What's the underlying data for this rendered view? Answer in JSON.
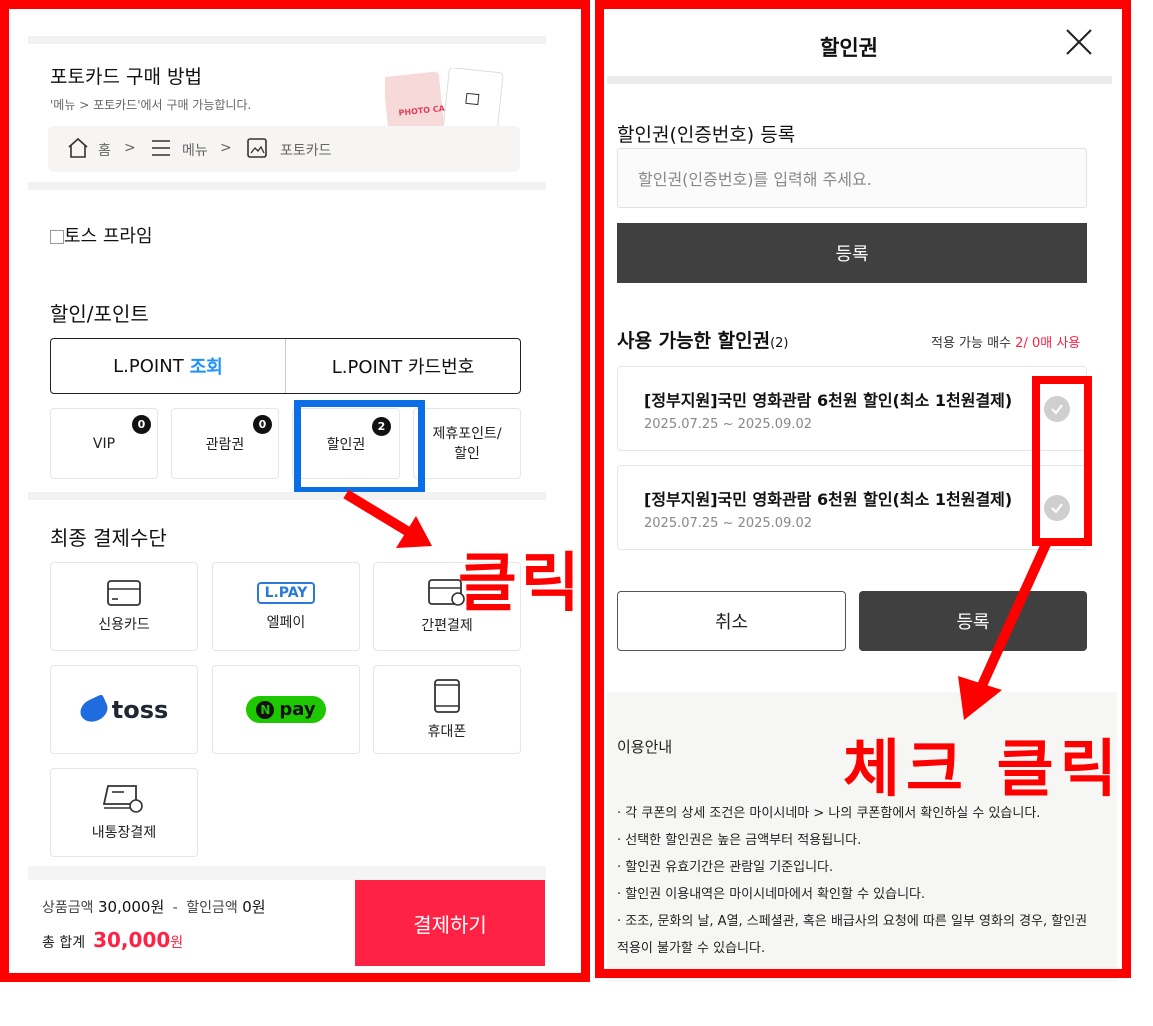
{
  "left": {
    "howto": {
      "title": "포토카드 구매 방법",
      "subtitle": "'메뉴 > 포토카드'에서 구매 가능합니다.",
      "breadcrumb": {
        "home": "홈",
        "sep1": ">",
        "menu": "메뉴",
        "sep2": ">",
        "photocard": "포토카드"
      },
      "card_text": "PHOTO CARD"
    },
    "toss_prime_alt": "토스 프라임",
    "discount_section_title": "할인/포인트",
    "lpoint": {
      "lookup_label": "L.POINT",
      "lookup_action": "조회",
      "card_label": "L.POINT 카드번호"
    },
    "discount_items": [
      {
        "label": "VIP",
        "badge": "0"
      },
      {
        "label": "관람권",
        "badge": "0"
      },
      {
        "label": "할인권",
        "badge": "2"
      },
      {
        "label": "제휴포인트/\n할인",
        "badge": ""
      }
    ],
    "payment_section_title": "최종 결제수단",
    "payment_methods": [
      {
        "label": "신용카드",
        "icon": "credit-card-icon"
      },
      {
        "label": "엘페이",
        "icon": "lpay-logo",
        "logo_text": "L.PAY"
      },
      {
        "label": "간편결제",
        "icon": "easy-pay-card-icon"
      },
      {
        "label": "",
        "icon": "toss-logo",
        "logo_text": "toss"
      },
      {
        "label": "",
        "icon": "npay-logo",
        "logo_text": "pay",
        "logo_mark": "N"
      },
      {
        "label": "휴대폰",
        "icon": "mobile-phone-icon"
      },
      {
        "label": "내통장결제",
        "icon": "bank-account-icon"
      }
    ],
    "annotation": "클릭",
    "footer": {
      "product_label": "상품금액",
      "product_amount": "30,000원",
      "minus": "-",
      "discount_label": "할인금액",
      "discount_amount": "0원",
      "total_label": "총 합계",
      "total_amount": "30,000",
      "total_unit": "원",
      "pay_button": "결제하기"
    }
  },
  "right": {
    "title": "할인권",
    "coupon_register_label": "할인권(인증번호) 등록",
    "coupon_input_placeholder": "할인권(인증번호)를 입력해 주세요.",
    "register_button": "등록",
    "available_title": "사용 가능한 할인권",
    "available_count": "(2)",
    "apply_count_label": "적용 가능 매수",
    "apply_count_value": "2/ 0매 사용",
    "coupons": [
      {
        "name": "[정부지원]국민 영화관람 6천원 할인(최소 1천원결제)",
        "period": "2025.07.25 ~ 2025.09.02"
      },
      {
        "name": "[정부지원]국민 영화관람 6천원 할인(최소 1천원결제)",
        "period": "2025.07.25 ~ 2025.09.02"
      }
    ],
    "cancel_button": "취소",
    "confirm_button": "등록",
    "annotation": "체크 클릭",
    "info_title": "이용안내",
    "info_items": [
      "· 각 쿠폰의 상세 조건은 마이시네마 > 나의 쿠폰함에서 확인하실 수 있습니다.",
      "· 선택한 할인권은 높은 금액부터 적용됩니다.",
      "· 할인권 유효기간은 관람일 기준입니다.",
      "· 할인권 이용내역은 마이시네마에서 확인할 수 있습니다.",
      "· 조조, 문화의 날, A열, 스페셜관, 혹은 배급사의 요청에 따른 일부 영화의 경우, 할인권 적용이 불가할 수 있습니다."
    ]
  },
  "colors": {
    "accent_red": "#ff2245",
    "annotation_red": "#ff0000",
    "highlight_blue": "#0a6fe6",
    "lpoint_blue": "#1e90ff"
  }
}
